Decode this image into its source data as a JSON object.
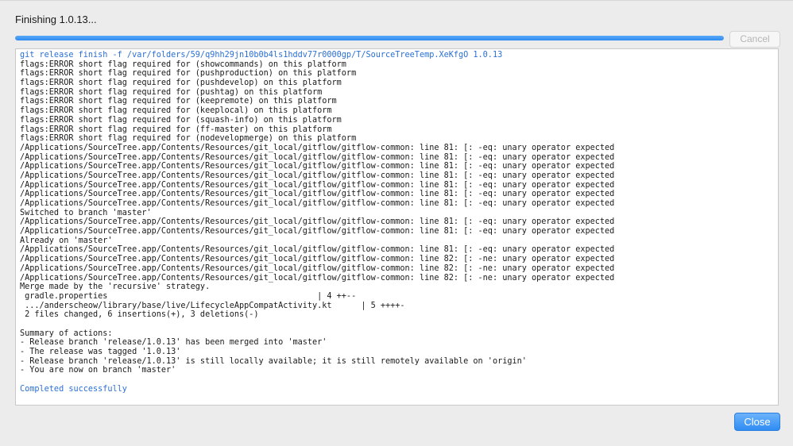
{
  "dialog": {
    "title": "Finishing 1.0.13...",
    "progress_percent": 100,
    "cancel_label": "Cancel",
    "close_label": "Close",
    "accent_color": "#2d8cf0"
  },
  "log": {
    "lines": [
      {
        "text": "git release finish -f /var/folders/59/q9hh29jn10b0b4ls1hddv77r0000gp/T/SourceTreeTemp.XeKfgO 1.0.13",
        "color": "blue"
      },
      {
        "text": "flags:ERROR short flag required for (showcommands) on this platform",
        "color": "black"
      },
      {
        "text": "flags:ERROR short flag required for (pushproduction) on this platform",
        "color": "black"
      },
      {
        "text": "flags:ERROR short flag required for (pushdevelop) on this platform",
        "color": "black"
      },
      {
        "text": "flags:ERROR short flag required for (pushtag) on this platform",
        "color": "black"
      },
      {
        "text": "flags:ERROR short flag required for (keepremote) on this platform",
        "color": "black"
      },
      {
        "text": "flags:ERROR short flag required for (keeplocal) on this platform",
        "color": "black"
      },
      {
        "text": "flags:ERROR short flag required for (squash-info) on this platform",
        "color": "black"
      },
      {
        "text": "flags:ERROR short flag required for (ff-master) on this platform",
        "color": "black"
      },
      {
        "text": "flags:ERROR short flag required for (nodevelopmerge) on this platform",
        "color": "black"
      },
      {
        "text": "/Applications/SourceTree.app/Contents/Resources/git_local/gitflow/gitflow-common: line 81: [: -eq: unary operator expected",
        "color": "black"
      },
      {
        "text": "/Applications/SourceTree.app/Contents/Resources/git_local/gitflow/gitflow-common: line 81: [: -eq: unary operator expected",
        "color": "black"
      },
      {
        "text": "/Applications/SourceTree.app/Contents/Resources/git_local/gitflow/gitflow-common: line 81: [: -eq: unary operator expected",
        "color": "black"
      },
      {
        "text": "/Applications/SourceTree.app/Contents/Resources/git_local/gitflow/gitflow-common: line 81: [: -eq: unary operator expected",
        "color": "black"
      },
      {
        "text": "/Applications/SourceTree.app/Contents/Resources/git_local/gitflow/gitflow-common: line 81: [: -eq: unary operator expected",
        "color": "black"
      },
      {
        "text": "/Applications/SourceTree.app/Contents/Resources/git_local/gitflow/gitflow-common: line 81: [: -eq: unary operator expected",
        "color": "black"
      },
      {
        "text": "/Applications/SourceTree.app/Contents/Resources/git_local/gitflow/gitflow-common: line 81: [: -eq: unary operator expected",
        "color": "black"
      },
      {
        "text": "Switched to branch 'master'",
        "color": "black"
      },
      {
        "text": "/Applications/SourceTree.app/Contents/Resources/git_local/gitflow/gitflow-common: line 81: [: -eq: unary operator expected",
        "color": "black"
      },
      {
        "text": "/Applications/SourceTree.app/Contents/Resources/git_local/gitflow/gitflow-common: line 81: [: -eq: unary operator expected",
        "color": "black"
      },
      {
        "text": "Already on 'master'",
        "color": "black"
      },
      {
        "text": "/Applications/SourceTree.app/Contents/Resources/git_local/gitflow/gitflow-common: line 81: [: -eq: unary operator expected",
        "color": "black"
      },
      {
        "text": "/Applications/SourceTree.app/Contents/Resources/git_local/gitflow/gitflow-common: line 82: [: -ne: unary operator expected",
        "color": "black"
      },
      {
        "text": "/Applications/SourceTree.app/Contents/Resources/git_local/gitflow/gitflow-common: line 82: [: -ne: unary operator expected",
        "color": "black"
      },
      {
        "text": "/Applications/SourceTree.app/Contents/Resources/git_local/gitflow/gitflow-common: line 82: [: -ne: unary operator expected",
        "color": "black"
      },
      {
        "text": "Merge made by the 'recursive' strategy.",
        "color": "black"
      },
      {
        "text": " gradle.properties                                           | 4 ++--",
        "color": "black"
      },
      {
        "text": " .../anderscheow/library/base/live/LifecycleAppCompatActivity.kt      | 5 ++++-",
        "color": "black"
      },
      {
        "text": " 2 files changed, 6 insertions(+), 3 deletions(-)",
        "color": "black"
      },
      {
        "text": "",
        "color": "black"
      },
      {
        "text": "Summary of actions:",
        "color": "black"
      },
      {
        "text": "- Release branch 'release/1.0.13' has been merged into 'master'",
        "color": "black"
      },
      {
        "text": "- The release was tagged '1.0.13'",
        "color": "black"
      },
      {
        "text": "- Release branch 'release/1.0.13' is still locally available; it is still remotely available on 'origin'",
        "color": "black"
      },
      {
        "text": "- You are now on branch 'master'",
        "color": "black"
      },
      {
        "text": "",
        "color": "black"
      },
      {
        "text": "Completed successfully",
        "color": "blue"
      }
    ]
  }
}
